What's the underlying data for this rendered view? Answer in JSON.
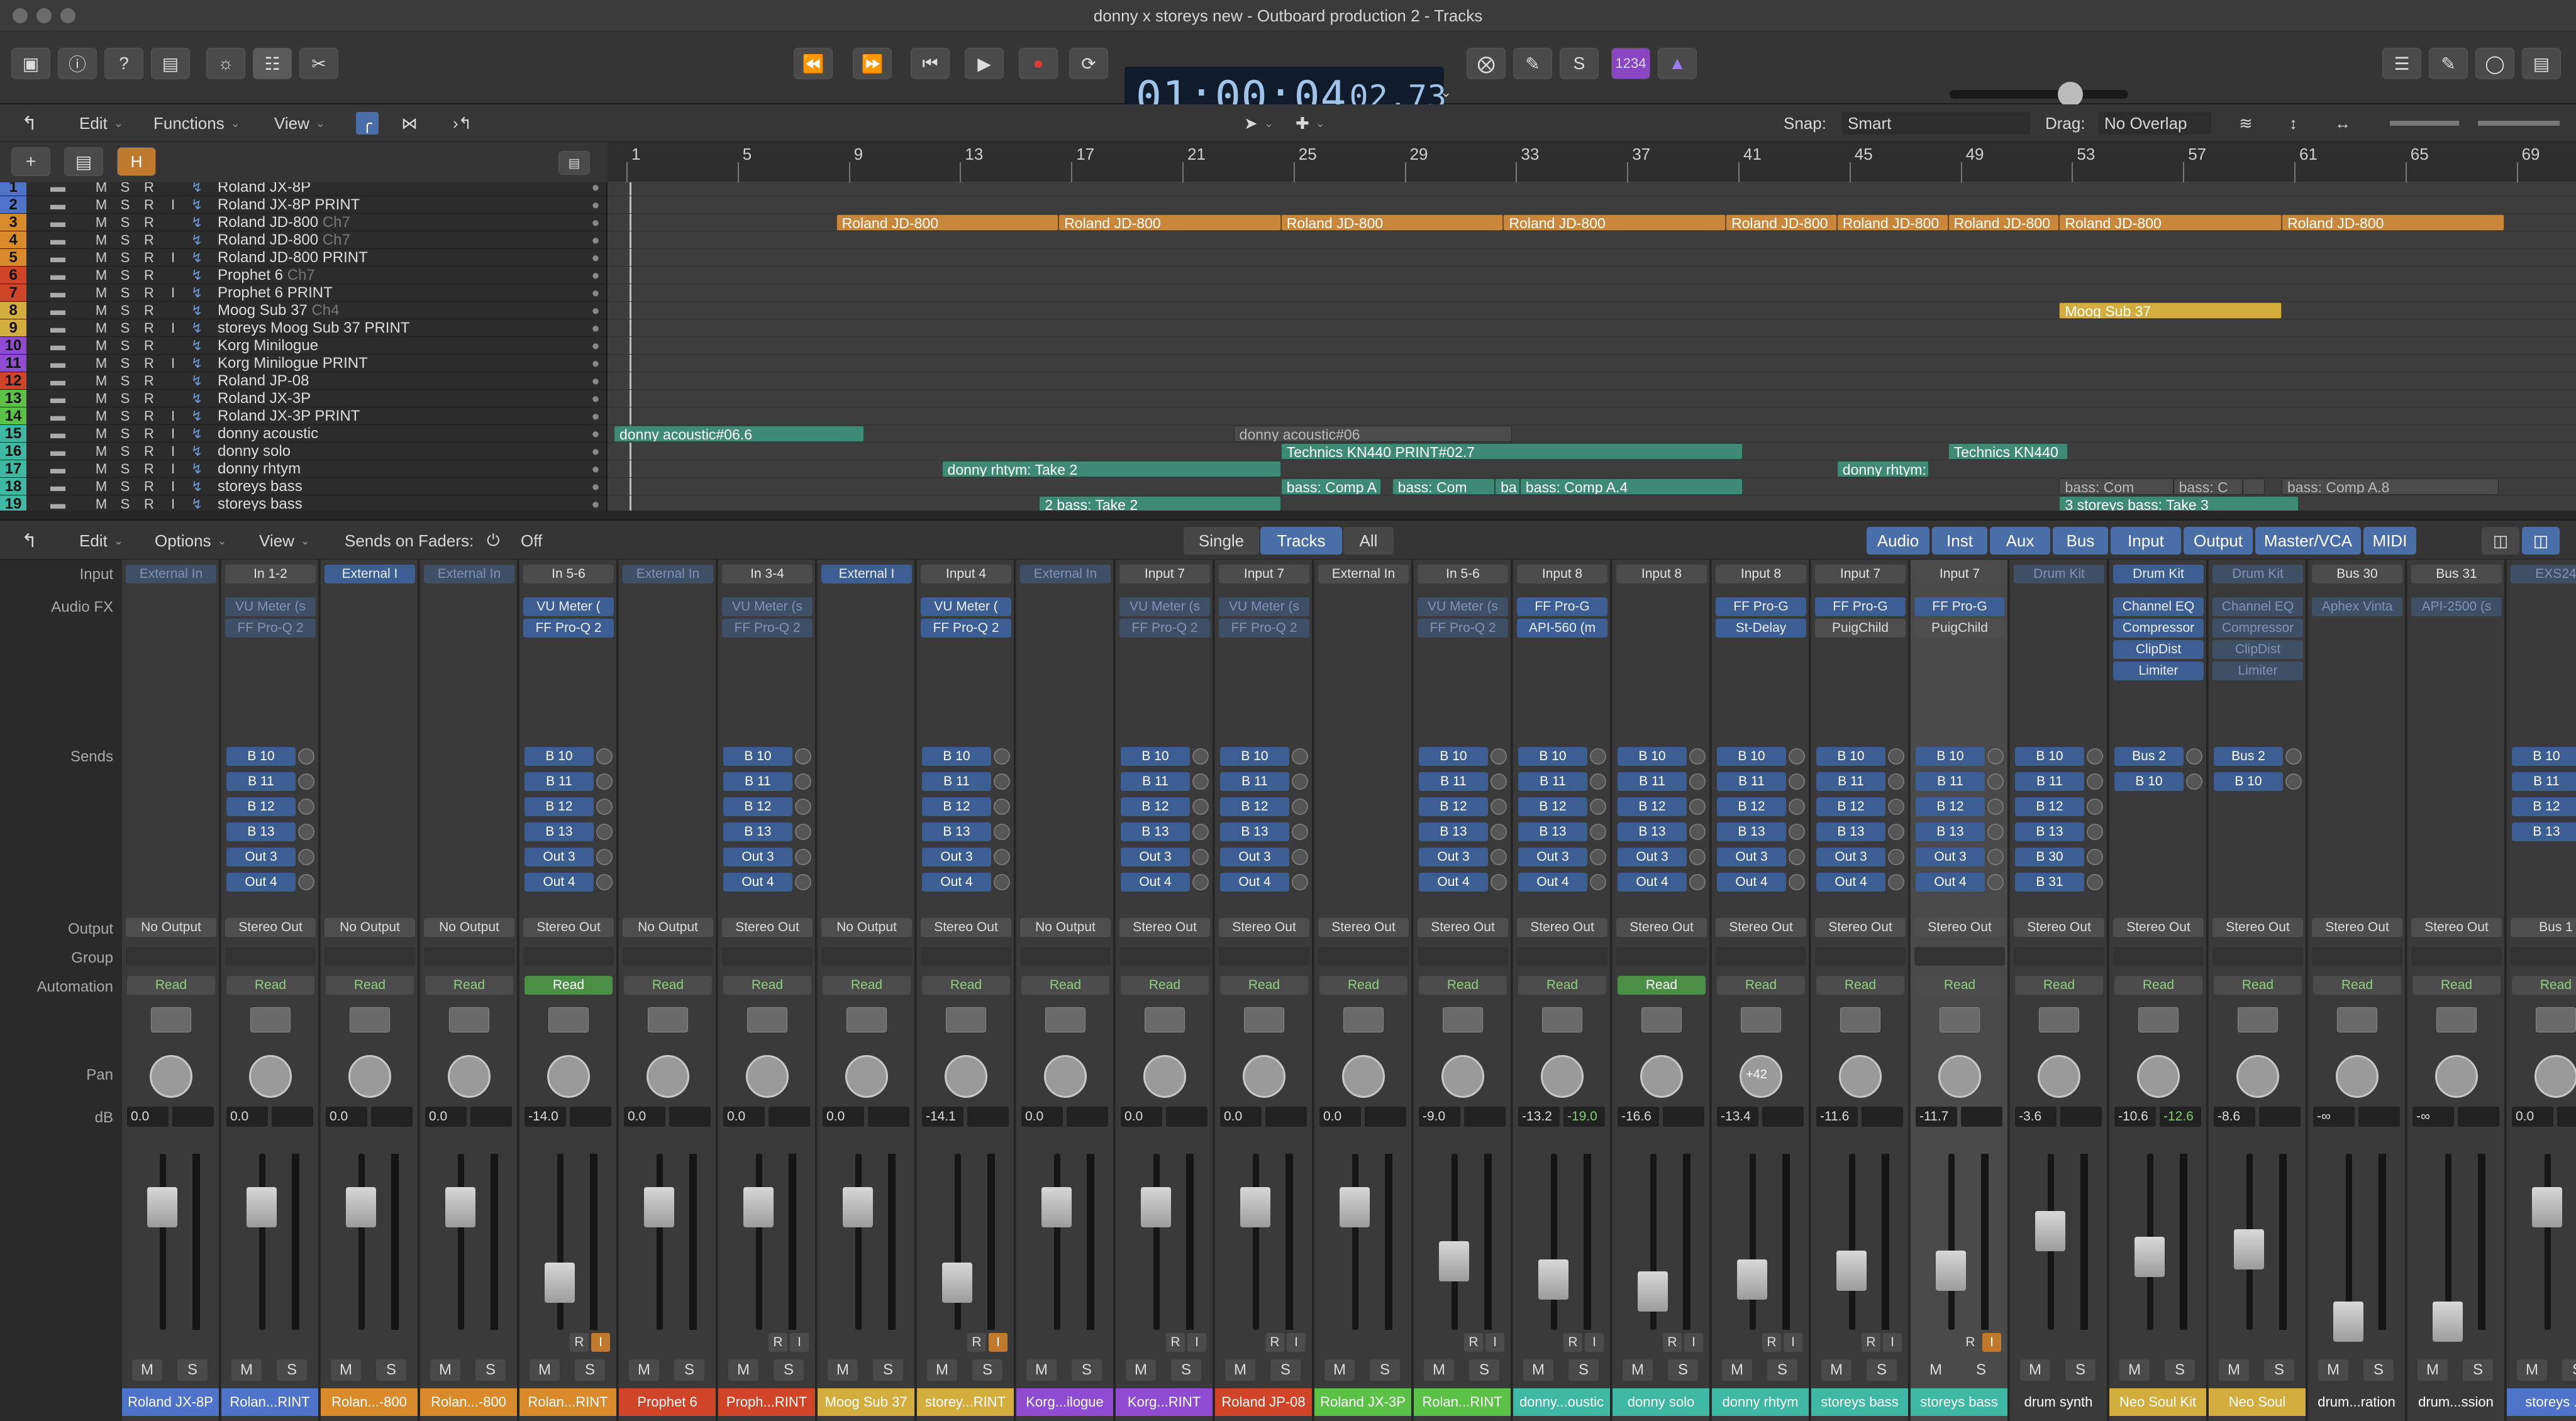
{
  "window": {
    "title": "donny x storeys new - Outboard production 2 - Tracks"
  },
  "control_bar": {
    "lcd_main": "01:00:04",
    "lcd_sub": "02.73",
    "key_badge": "1234"
  },
  "menu": {
    "edit": "Edit",
    "functions": "Functions",
    "view": "View",
    "snap_label": "Snap:",
    "snap_value": "Smart",
    "drag_label": "Drag:",
    "drag_value": "No Overlap",
    "h_badge": "H"
  },
  "ruler": [
    "1",
    "5",
    "9",
    "13",
    "17",
    "21",
    "25",
    "29",
    "33",
    "37",
    "41",
    "45",
    "49",
    "53",
    "57",
    "61",
    "65",
    "69"
  ],
  "tracks": [
    {
      "num": "1",
      "color": "#4f73c9",
      "name": "Roland JX-8P",
      "suffix": "",
      "m": "M",
      "s": "S",
      "r": "R",
      "i": ""
    },
    {
      "num": "2",
      "color": "#4f73c9",
      "name": "Roland JX-8P PRINT",
      "suffix": "",
      "m": "M",
      "s": "S",
      "r": "R",
      "i": "I"
    },
    {
      "num": "3",
      "color": "#d98a2a",
      "name": "Roland JD-800",
      "suffix": "Ch7",
      "m": "M",
      "s": "S",
      "r": "R",
      "i": ""
    },
    {
      "num": "4",
      "color": "#d98a2a",
      "name": "Roland JD-800",
      "suffix": "Ch7",
      "m": "M",
      "s": "S",
      "r": "R",
      "i": ""
    },
    {
      "num": "5",
      "color": "#d98a2a",
      "name": "Roland JD-800 PRINT",
      "suffix": "",
      "m": "M",
      "s": "S",
      "r": "R",
      "i": "I"
    },
    {
      "num": "6",
      "color": "#d04528",
      "name": "Prophet 6",
      "suffix": "Ch7",
      "m": "M",
      "s": "S",
      "r": "R",
      "i": ""
    },
    {
      "num": "7",
      "color": "#d04528",
      "name": "Prophet 6 PRINT",
      "suffix": "",
      "m": "M",
      "s": "S",
      "r": "R",
      "i": "I"
    },
    {
      "num": "8",
      "color": "#d4ad3f",
      "name": "Moog Sub 37",
      "suffix": "Ch4",
      "m": "M",
      "s": "S",
      "r": "R",
      "i": ""
    },
    {
      "num": "9",
      "color": "#d4ad3f",
      "name": "storeys Moog Sub 37 PRINT",
      "suffix": "",
      "m": "M",
      "s": "S",
      "r": "R",
      "i": "I"
    },
    {
      "num": "10",
      "color": "#8f4bd1",
      "name": "Korg Minilogue",
      "suffix": "",
      "m": "M",
      "s": "S",
      "r": "R",
      "i": ""
    },
    {
      "num": "11",
      "color": "#8f4bd1",
      "name": "Korg Minilogue PRINT",
      "suffix": "",
      "m": "M",
      "s": "S",
      "r": "R",
      "i": "I"
    },
    {
      "num": "12",
      "color": "#d04528",
      "name": "Roland JP-08",
      "suffix": "",
      "m": "M",
      "s": "S",
      "r": "R",
      "i": ""
    },
    {
      "num": "13",
      "color": "#5cc247",
      "name": "Roland JX-3P",
      "suffix": "",
      "m": "M",
      "s": "S",
      "r": "R",
      "i": ""
    },
    {
      "num": "14",
      "color": "#5cc247",
      "name": "Roland JX-3P PRINT",
      "suffix": "",
      "m": "M",
      "s": "S",
      "r": "R",
      "i": "I"
    },
    {
      "num": "15",
      "color": "#3fb8a3",
      "name": "donny acoustic",
      "suffix": "",
      "m": "M",
      "s": "S",
      "r": "R",
      "i": "I"
    },
    {
      "num": "16",
      "color": "#3fb8a3",
      "name": "donny solo",
      "suffix": "",
      "m": "M",
      "s": "S",
      "r": "R",
      "i": "I"
    },
    {
      "num": "17",
      "color": "#3fb8a3",
      "name": "donny rhtym",
      "suffix": "",
      "m": "M",
      "s": "S",
      "r": "R",
      "i": "I"
    },
    {
      "num": "18",
      "color": "#3fb8a3",
      "name": "storeys bass",
      "suffix": "",
      "m": "M",
      "s": "S",
      "r": "R",
      "i": "I"
    },
    {
      "num": "19",
      "color": "#3fb8a3",
      "name": "storeys bass",
      "suffix": "",
      "m": "M",
      "s": "S",
      "r": "R",
      "i": "I"
    }
  ],
  "regions": [
    {
      "lane": 2,
      "start": 9,
      "end": 17,
      "label": "Roland JD-800",
      "style": "orange"
    },
    {
      "lane": 2,
      "start": 17,
      "end": 25,
      "label": "Roland JD-800",
      "style": "orange"
    },
    {
      "lane": 2,
      "start": 25,
      "end": 33,
      "label": "Roland JD-800",
      "style": "orange"
    },
    {
      "lane": 2,
      "start": 33,
      "end": 41,
      "label": "Roland JD-800",
      "style": "orange"
    },
    {
      "lane": 2,
      "start": 41,
      "end": 45,
      "label": "Roland JD-800",
      "style": "orange"
    },
    {
      "lane": 2,
      "start": 45,
      "end": 49,
      "label": "Roland JD-800",
      "style": "orange"
    },
    {
      "lane": 2,
      "start": 49,
      "end": 53,
      "label": "Roland JD-800",
      "style": "orange"
    },
    {
      "lane": 2,
      "start": 53,
      "end": 61,
      "label": "Roland JD-800",
      "style": "orange"
    },
    {
      "lane": 2,
      "start": 61,
      "end": 69,
      "label": "Roland JD-800",
      "style": "orange"
    },
    {
      "lane": 7,
      "start": 53,
      "end": 61,
      "label": "Moog Sub 37",
      "style": "yellow"
    },
    {
      "lane": 14,
      "start": 1,
      "end": 10,
      "label": "donny acoustic#06.6",
      "style": "green"
    },
    {
      "lane": 14,
      "start": 23.3,
      "end": 33.3,
      "label": "donny acoustic#06",
      "style": "dim"
    },
    {
      "lane": 15,
      "start": 25,
      "end": 41.6,
      "label": "Technics KN440 PRINT#02.7",
      "style": "green"
    },
    {
      "lane": 15,
      "start": 49,
      "end": 53.3,
      "label": "Technics KN440",
      "style": "green"
    },
    {
      "lane": 16,
      "start": 12.8,
      "end": 25,
      "label": "donny rhtym: Take 2",
      "style": "green"
    },
    {
      "lane": 16,
      "start": 45,
      "end": 48.3,
      "label": "donny rhtym:",
      "style": "green"
    },
    {
      "lane": 17,
      "start": 25,
      "end": 28.6,
      "label": "bass: Comp A",
      "style": "green"
    },
    {
      "lane": 17,
      "start": 29,
      "end": 32.7,
      "label": "bass: Com",
      "style": "green"
    },
    {
      "lane": 17,
      "start": 32.7,
      "end": 33.6,
      "label": "ba",
      "style": "green"
    },
    {
      "lane": 17,
      "start": 33.6,
      "end": 41.6,
      "label": "bass: Comp A.4",
      "style": "green"
    },
    {
      "lane": 17,
      "start": 53,
      "end": 57.1,
      "label": "bass: Com",
      "style": "dim"
    },
    {
      "lane": 17,
      "start": 57.1,
      "end": 59.6,
      "label": "bass: C",
      "style": "dim"
    },
    {
      "lane": 17,
      "start": 59.6,
      "end": 60.4,
      "label": "",
      "style": "dim"
    },
    {
      "lane": 17,
      "start": 61,
      "end": 68.8,
      "label": "bass: Comp A.8",
      "style": "dim"
    },
    {
      "lane": 18,
      "start": 16.3,
      "end": 25,
      "label": "2   bass: Take 2",
      "style": "green"
    },
    {
      "lane": 18,
      "start": 53,
      "end": 61.6,
      "label": "3   storeys bass: Take 3",
      "style": "green"
    }
  ],
  "mixer_tabs": {
    "edit": "Edit",
    "options": "Options",
    "view": "View",
    "sends_on_faders": "Sends on Faders:",
    "sends_value": "Off",
    "single": "Single",
    "tracks": "Tracks",
    "all": "All",
    "filters": [
      "Audio",
      "Inst",
      "Aux",
      "Bus",
      "Input",
      "Output",
      "Master/VCA",
      "MIDI"
    ]
  },
  "row_labels": {
    "input": "Input",
    "audio_fx": "Audio FX",
    "sends": "Sends",
    "output": "Output",
    "group": "Group",
    "automation": "Automation",
    "pan": "Pan",
    "db": "dB"
  },
  "strips": [
    {
      "input": "External In",
      "input_style": "dim",
      "fx": [],
      "sends": [],
      "output": "No Output",
      "auto": "Read",
      "auto_on": false,
      "db": "0.0",
      "db2": "",
      "fader": 0.78,
      "r": "",
      "i": "",
      "name": "Roland JX-8P",
      "color": "#4f73c9"
    },
    {
      "input": "In 1-2",
      "input_style": "in",
      "fx": [
        {
          "l": "VU Meter (s",
          "s": "dim"
        },
        {
          "l": "FF Pro-Q 2",
          "s": "dim"
        }
      ],
      "sends": [
        "B 10",
        "B 11",
        "B 12",
        "B 13",
        "Out 3",
        "Out 4"
      ],
      "output": "Stereo Out",
      "auto": "Read",
      "auto_on": false,
      "db": "0.0",
      "db2": "",
      "fader": 0.78,
      "r": "",
      "i": "",
      "name": "Rolan...RINT",
      "color": "#4f73c9"
    },
    {
      "input": "External I",
      "input_style": "blue",
      "fx": [],
      "sends": [],
      "output": "No Output",
      "auto": "Read",
      "auto_on": false,
      "db": "0.0",
      "db2": "",
      "fader": 0.78,
      "r": "",
      "i": "",
      "name": "Rolan...-800",
      "color": "#d98a2a"
    },
    {
      "input": "External In",
      "input_style": "dim",
      "fx": [],
      "sends": [],
      "output": "No Output",
      "auto": "Read",
      "auto_on": false,
      "db": "0.0",
      "db2": "",
      "fader": 0.78,
      "r": "",
      "i": "",
      "name": "Rolan...-800",
      "color": "#d98a2a"
    },
    {
      "input": "In 5-6",
      "input_style": "in",
      "fx": [
        {
          "l": "VU Meter (",
          "s": "blue"
        },
        {
          "l": "FF Pro-Q 2",
          "s": "blue"
        }
      ],
      "sends": [
        "B 10",
        "B 11",
        "B 12",
        "B 13",
        "Out 3",
        "Out 4"
      ],
      "output": "Stereo Out",
      "auto": "Read",
      "auto_on": true,
      "db": "-14.0",
      "db2": "",
      "fader": 0.28,
      "r": "R",
      "i": "I",
      "i_on": true,
      "name": "Rolan...RINT",
      "color": "#d98a2a"
    },
    {
      "input": "External In",
      "input_style": "dim",
      "fx": [],
      "sends": [],
      "output": "No Output",
      "auto": "Read",
      "auto_on": false,
      "db": "0.0",
      "db2": "",
      "fader": 0.78,
      "r": "",
      "i": "",
      "name": "Prophet 6",
      "color": "#d04528"
    },
    {
      "input": "In 3-4",
      "input_style": "in",
      "fx": [
        {
          "l": "VU Meter (s",
          "s": "dim"
        },
        {
          "l": "FF Pro-Q 2",
          "s": "dim"
        }
      ],
      "sends": [
        "B 10",
        "B 11",
        "B 12",
        "B 13",
        "Out 3",
        "Out 4"
      ],
      "output": "Stereo Out",
      "auto": "Read",
      "auto_on": false,
      "db": "0.0",
      "db2": "",
      "fader": 0.78,
      "r": "R",
      "i": "I",
      "name": "Proph...RINT",
      "color": "#d04528"
    },
    {
      "input": "External I",
      "input_style": "blue",
      "fx": [],
      "sends": [],
      "output": "No Output",
      "auto": "Read",
      "auto_on": false,
      "db": "0.0",
      "db2": "",
      "fader": 0.78,
      "r": "",
      "i": "",
      "name": "Moog Sub 37",
      "color": "#d4ad3f"
    },
    {
      "input": "Input 4",
      "input_style": "in",
      "fx": [
        {
          "l": "VU Meter (",
          "s": "blue"
        },
        {
          "l": "FF Pro-Q 2",
          "s": "blue"
        }
      ],
      "sends": [
        "B 10",
        "B 11",
        "B 12",
        "B 13",
        "Out 3",
        "Out 4"
      ],
      "output": "Stereo Out",
      "auto": "Read",
      "auto_on": false,
      "db": "-14.1",
      "db2": "",
      "fader": 0.28,
      "r": "R",
      "i": "I",
      "i_on": true,
      "name": "storey...RINT",
      "color": "#d4ad3f"
    },
    {
      "input": "External In",
      "input_style": "dim",
      "fx": [],
      "sends": [],
      "output": "No Output",
      "auto": "Read",
      "auto_on": false,
      "db": "0.0",
      "db2": "",
      "fader": 0.78,
      "r": "",
      "i": "",
      "name": "Korg...ilogue",
      "color": "#8f4bd1"
    },
    {
      "input": "Input 7",
      "input_style": "in",
      "fx": [
        {
          "l": "VU Meter (s",
          "s": "dim"
        },
        {
          "l": "FF Pro-Q 2",
          "s": "dim"
        }
      ],
      "sends": [
        "B 10",
        "B 11",
        "B 12",
        "B 13",
        "Out 3",
        "Out 4"
      ],
      "output": "Stereo Out",
      "auto": "Read",
      "auto_on": false,
      "db": "0.0",
      "db2": "",
      "fader": 0.78,
      "r": "R",
      "i": "I",
      "name": "Korg...RINT",
      "color": "#8f4bd1"
    },
    {
      "input": "Input 7",
      "input_style": "in",
      "fx": [
        {
          "l": "VU Meter (s",
          "s": "dim"
        },
        {
          "l": "FF Pro-Q 2",
          "s": "dim"
        }
      ],
      "sends": [
        "B 10",
        "B 11",
        "B 12",
        "B 13",
        "Out 3",
        "Out 4"
      ],
      "output": "Stereo Out",
      "auto": "Read",
      "auto_on": false,
      "db": "0.0",
      "db2": "",
      "fader": 0.78,
      "r": "R",
      "i": "I",
      "name": "Roland JP-08",
      "color": "#d04528"
    },
    {
      "input": "External In",
      "input_style": "in",
      "fx": [],
      "sends": [],
      "output": "Stereo Out",
      "auto": "Read",
      "auto_on": false,
      "db": "0.0",
      "db2": "",
      "fader": 0.78,
      "r": "",
      "i": "",
      "name": "Roland JX-3P",
      "color": "#5cc247"
    },
    {
      "input": "In 5-6",
      "input_style": "in",
      "fx": [
        {
          "l": "VU Meter (s",
          "s": "dim"
        },
        {
          "l": "FF Pro-Q 2",
          "s": "dim"
        }
      ],
      "sends": [
        "B 10",
        "B 11",
        "B 12",
        "B 13",
        "Out 3",
        "Out 4"
      ],
      "output": "Stereo Out",
      "auto": "Read",
      "auto_on": false,
      "db": "-9.0",
      "db2": "",
      "fader": 0.42,
      "r": "R",
      "i": "I",
      "name": "Rolan...RINT",
      "color": "#5cc247"
    },
    {
      "input": "Input 8",
      "input_style": "in",
      "fx": [
        {
          "l": "FF Pro-G",
          "s": "blue"
        },
        {
          "l": "API-560 (m",
          "s": "blue"
        }
      ],
      "sends": [
        "B 10",
        "B 11",
        "B 12",
        "B 13",
        "Out 3",
        "Out 4"
      ],
      "output": "Stereo Out",
      "auto": "Read",
      "auto_on": false,
      "db": "-13.2",
      "db2": "-19.0",
      "fader": 0.3,
      "r": "R",
      "i": "I",
      "name": "donny...oustic",
      "color": "#3fb8a3"
    },
    {
      "input": "Input 8",
      "input_style": "in",
      "fx": [],
      "sends": [
        "B 10",
        "B 11",
        "B 12",
        "B 13",
        "Out 3",
        "Out 4"
      ],
      "output": "Stereo Out",
      "auto": "Read",
      "auto_on": true,
      "db": "-16.6",
      "db2": "",
      "fader": 0.22,
      "r": "R",
      "i": "I",
      "name": "donny solo",
      "color": "#3fb8a3"
    },
    {
      "input": "Input 8",
      "input_style": "in",
      "fx": [
        {
          "l": "FF Pro-G",
          "s": "blue"
        },
        {
          "l": "St-Delay",
          "s": "blue"
        }
      ],
      "sends": [
        "B 10",
        "B 11",
        "B 12",
        "B 13",
        "Out 3",
        "Out 4"
      ],
      "output": "Stereo Out",
      "auto": "Read",
      "auto_on": false,
      "db": "-13.4",
      "db2": "",
      "fader": 0.3,
      "r": "R",
      "i": "I",
      "name": "donny rhtym",
      "color": "#3fb8a3",
      "pan_label": "+42"
    },
    {
      "input": "Input 7",
      "input_style": "in",
      "fx": [
        {
          "l": "FF Pro-G",
          "s": "blue"
        },
        {
          "l": "PuigChild",
          "s": "gray"
        }
      ],
      "sends": [
        "B 10",
        "B 11",
        "B 12",
        "B 13",
        "Out 3",
        "Out 4"
      ],
      "output": "Stereo Out",
      "auto": "Read",
      "auto_on": false,
      "db": "-11.6",
      "db2": "",
      "fader": 0.36,
      "r": "R",
      "i": "I",
      "name": "storeys bass",
      "color": "#3fb8a3"
    },
    {
      "input": "Input 7",
      "input_style": "in",
      "fx": [
        {
          "l": "FF Pro-G",
          "s": "blue"
        },
        {
          "l": "PuigChild",
          "s": "gray"
        }
      ],
      "sends": [
        "B 10",
        "B 11",
        "B 12",
        "B 13",
        "Out 3",
        "Out 4"
      ],
      "output": "Stereo Out",
      "auto": "Read",
      "auto_on": false,
      "db": "-11.7",
      "db2": "",
      "fader": 0.36,
      "r": "R",
      "i": "I",
      "i_on": true,
      "name": "storeys bass",
      "color": "#3fb8a3",
      "selected": true
    },
    {
      "input": "Drum Kit",
      "input_style": "dim",
      "fx": [],
      "sends": [
        "B 10",
        "B 11",
        "B 12",
        "B 13",
        "B 30",
        "B 31"
      ],
      "output": "Stereo Out",
      "auto": "Read",
      "auto_on": false,
      "db": "-3.6",
      "db2": "",
      "fader": 0.62,
      "r": "",
      "i": "",
      "name": "drum synth",
      "color": "#3a3a3a"
    },
    {
      "input": "Drum Kit",
      "input_style": "blue",
      "fx": [
        {
          "l": "Channel EQ",
          "s": "blue"
        },
        {
          "l": "Compressor",
          "s": "blue"
        },
        {
          "l": "ClipDist",
          "s": "blue"
        },
        {
          "l": "Limiter",
          "s": "blue"
        }
      ],
      "sends": [
        "Bus 2",
        "B 10"
      ],
      "output": "Stereo Out",
      "auto": "Read",
      "auto_on": false,
      "db": "-10.6",
      "db2": "-12.6",
      "fader": 0.45,
      "r": "",
      "i": "",
      "name": "Neo Soul Kit",
      "color": "#d4ad3f"
    },
    {
      "input": "Drum Kit",
      "input_style": "dim",
      "fx": [
        {
          "l": "Channel EQ",
          "s": "dim"
        },
        {
          "l": "Compressor",
          "s": "dim"
        },
        {
          "l": "ClipDist",
          "s": "dim"
        },
        {
          "l": "Limiter",
          "s": "dim"
        }
      ],
      "sends": [
        "Bus 2",
        "B 10"
      ],
      "output": "Stereo Out",
      "auto": "Read",
      "auto_on": false,
      "db": "-8.6",
      "db2": "",
      "fader": 0.5,
      "r": "",
      "i": "",
      "name": "Neo Soul",
      "color": "#d4ad3f"
    },
    {
      "input": "Bus 30",
      "input_style": "in",
      "fx": [
        {
          "l": "Aphex Vinta",
          "s": "dim"
        }
      ],
      "sends": [],
      "output": "Stereo Out",
      "auto": "Read",
      "auto_on": false,
      "db": "-∞",
      "db2": "",
      "fader": 0.02,
      "r": "",
      "i": "",
      "name": "drum...ration",
      "color": "#3a3a3a"
    },
    {
      "input": "Bus 31",
      "input_style": "in",
      "fx": [
        {
          "l": "API-2500 (s",
          "s": "dim"
        }
      ],
      "sends": [],
      "output": "Stereo Out",
      "auto": "Read",
      "auto_on": false,
      "db": "-∞",
      "db2": "",
      "fader": 0.02,
      "r": "",
      "i": "",
      "name": "drum...ssion",
      "color": "#3a3a3a"
    },
    {
      "input": "EXS24",
      "input_style": "dim",
      "fx": [],
      "sends": [
        "B 10",
        "B 11",
        "B 12",
        "B 13"
      ],
      "output": "Bus 1",
      "auto": "Read",
      "auto_on": false,
      "db": "0.0",
      "db2": "",
      "fader": 0.78,
      "r": "",
      "i": "",
      "name": "storeys ...",
      "color": "#4f73c9"
    }
  ]
}
